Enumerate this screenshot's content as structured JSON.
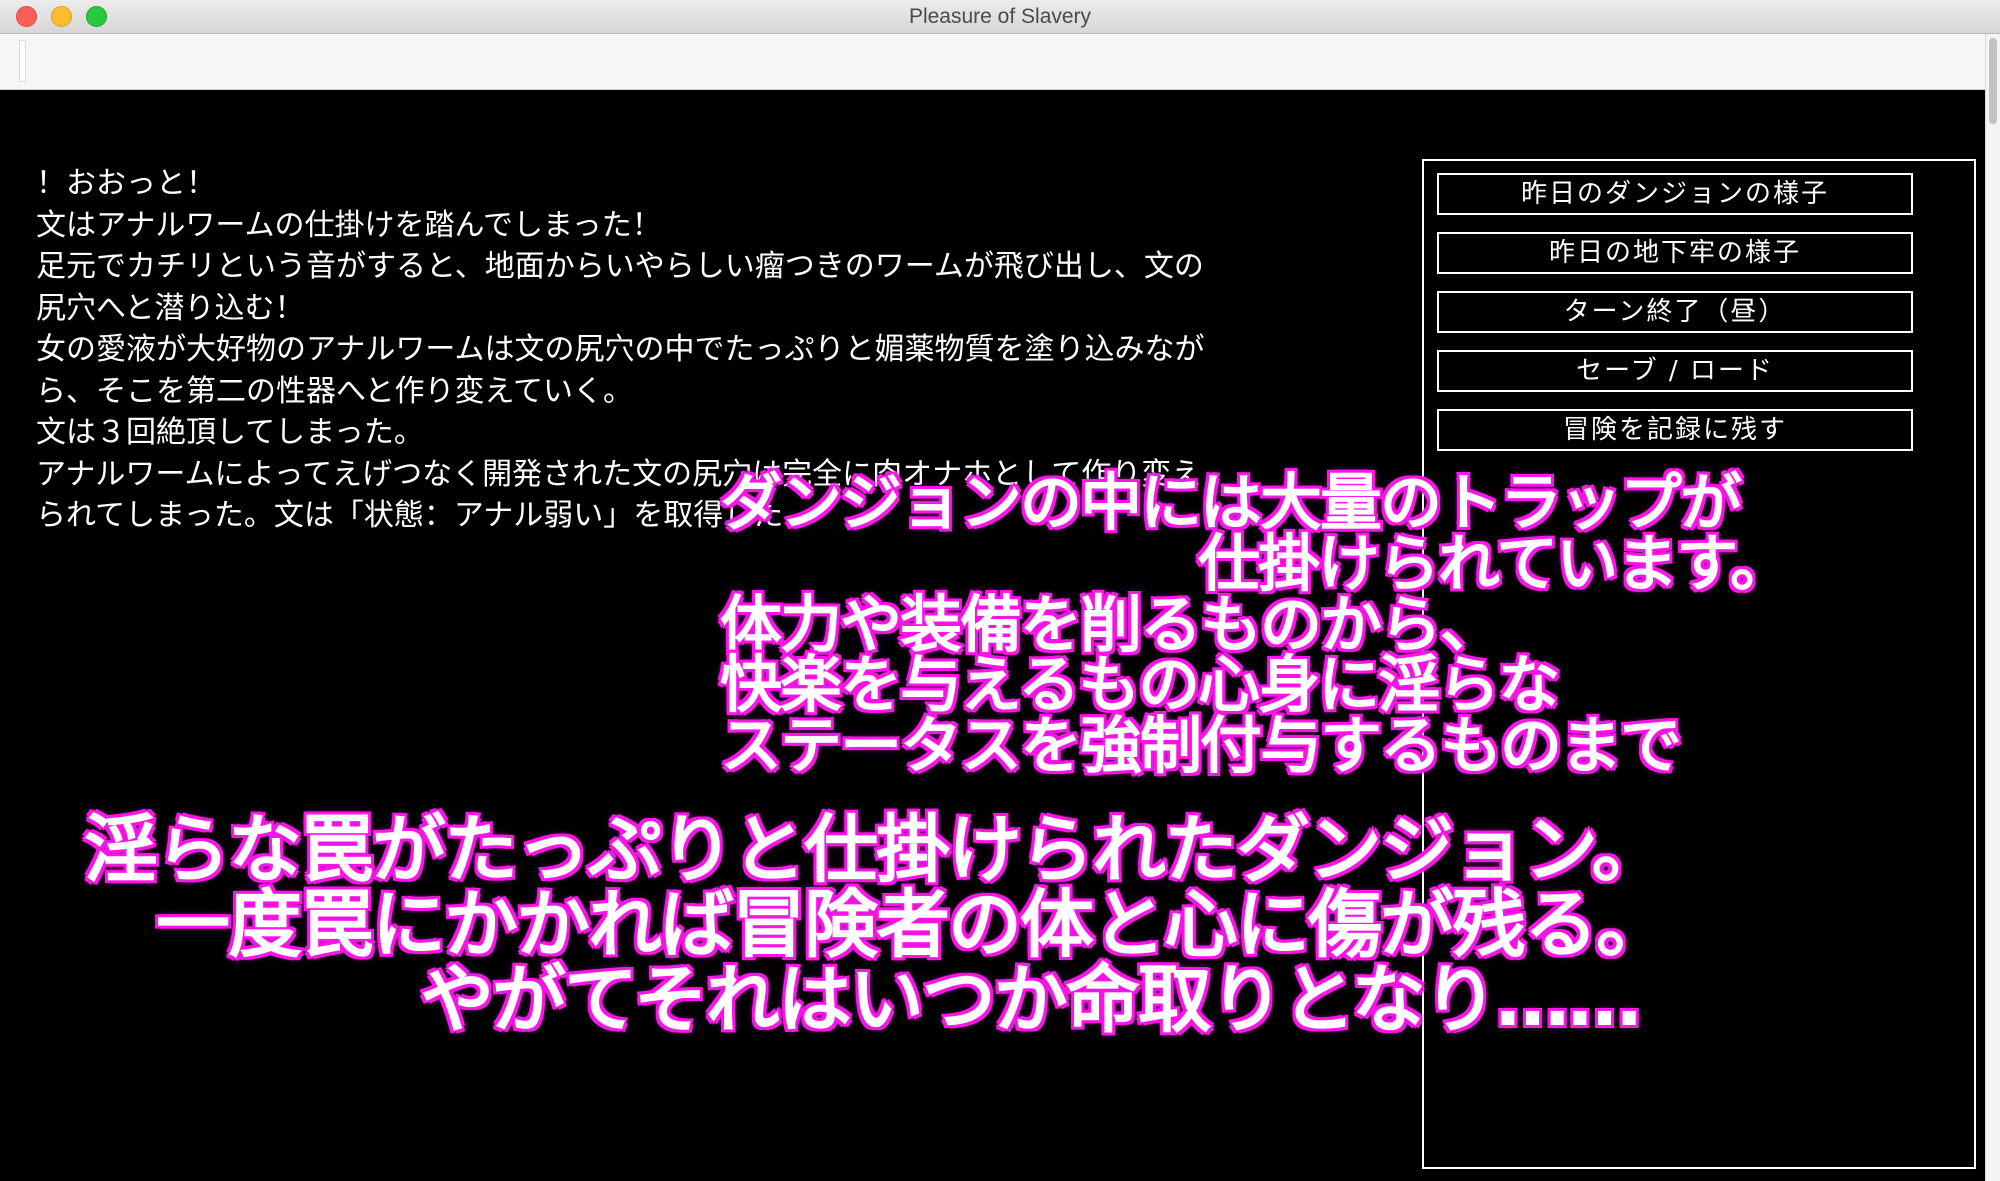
{
  "window": {
    "title": "Pleasure of Slavery"
  },
  "log": {
    "lines": [
      "！おおっと！",
      "文はアナルワームの仕掛けを踏んでしまった！",
      "足元でカチリという音がすると、地面からいやらしい瘤つきのワームが飛び出し、文の",
      "尻穴へと潜り込む！",
      "女の愛液が大好物のアナルワームは文の尻穴の中でたっぷりと媚薬物質を塗り込みなが",
      "ら、そこを第二の性器へと作り変えていく。",
      "文は３回絶頂してしまった。",
      "アナルワームによってえげつなく開発された文の尻穴は完全に肉オナホとして作り変え",
      "られてしまった。文は「状態：アナル弱い」を取得した"
    ]
  },
  "menu": {
    "items": [
      "昨日のダンジョンの様子",
      "昨日の地下牢の様子",
      "ターン終了（昼）",
      "セーブ / ロード",
      "冒険を記録に残す"
    ]
  },
  "promo": {
    "lines": [
      "ダンジョンの中には大量のトラップが",
      "仕掛けられています。",
      "体力や装備を削るものから、",
      "快楽を与えるもの心身に淫らな",
      "ステータスを強制付与するものまで",
      "淫らな罠がたっぷりと仕掛けられたダンジョン。",
      "一度罠にかかれば冒険者の体と心に傷が残る。",
      "やがてそれはいつか命取りとなり……"
    ]
  },
  "colors": {
    "caption_outline": "#ff1ee8",
    "background": "#000000",
    "text": "#ffffff"
  }
}
